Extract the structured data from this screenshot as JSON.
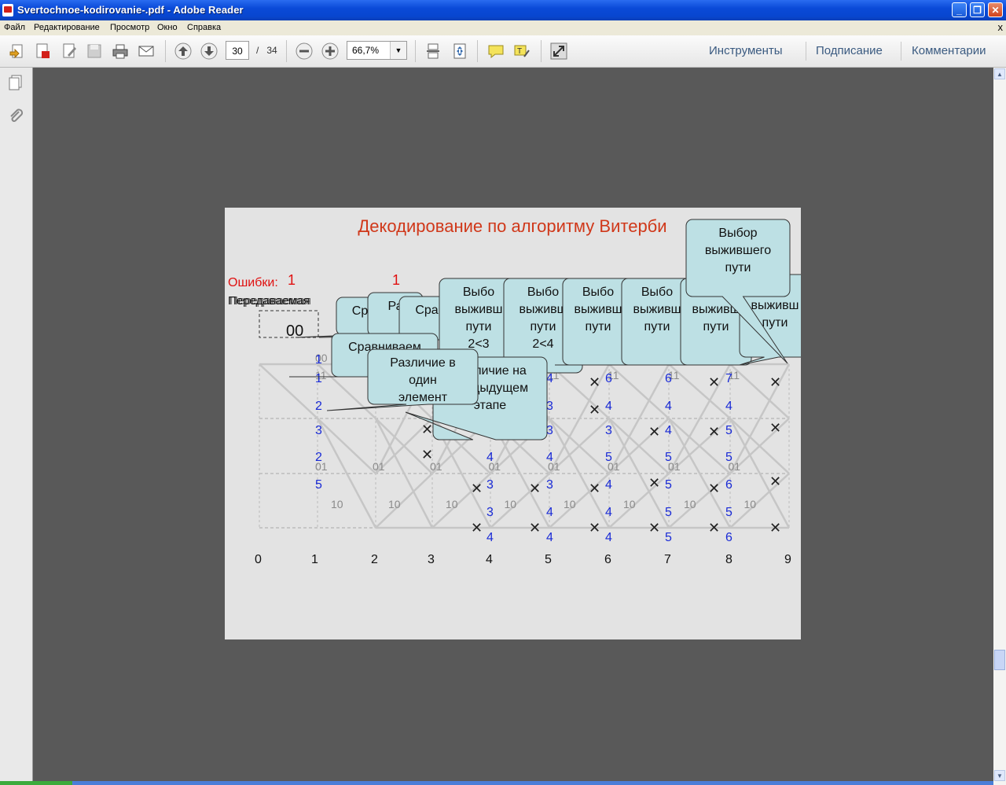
{
  "window": {
    "title": "Svertochnoe-kodirovanie-.pdf - Adobe Reader"
  },
  "menu": [
    "Файл",
    "Редактирование",
    "Просмотр",
    "Окно",
    "Справка"
  ],
  "menu_close": "x",
  "toolbar": {
    "page_current": "30",
    "page_sep": "/",
    "page_total": "34",
    "zoom": "66,7%",
    "right_links": [
      "Инструменты",
      "Подписание",
      "Комментарии"
    ]
  },
  "slide": {
    "title": "Декодирование по алгоритму Витерби",
    "errors_label": "Ошибки:",
    "errors_vals": [
      "1",
      "1"
    ],
    "seq_label": "Передаваемая",
    "seq_value": "00",
    "stage_labels": [
      "0",
      "1",
      "2",
      "3",
      "4",
      "5",
      "6",
      "7",
      "8",
      "9"
    ],
    "metric_values": [
      [
        "1",
        "1",
        "2",
        "3",
        "2",
        "5",
        "4",
        "3"
      ],
      [
        "2",
        "2",
        "3",
        "5",
        "4",
        "3",
        "3",
        "4"
      ],
      [
        "5",
        "4",
        "3",
        "3",
        "4",
        "3",
        "4",
        "4"
      ],
      [
        "2",
        "6",
        "4",
        "3",
        "5",
        "4",
        "4",
        "4"
      ],
      [
        "2",
        "6",
        "4",
        "4",
        "5",
        "5",
        "5",
        "5"
      ],
      [
        "2",
        "7",
        "4",
        "5",
        "5",
        "6",
        "5",
        "6"
      ]
    ],
    "edge_labels": [
      "00",
      "11",
      "01",
      "10"
    ],
    "callouts": {
      "main": [
        "Выбор",
        "выжившего",
        "пути"
      ],
      "diff_one": [
        "Различие в",
        "один",
        "элемент"
      ],
      "compare": "Сравниваем",
      "diff_prev": [
        "Различие на",
        "предыдущем",
        "этапе"
      ],
      "back_fragments": [
        "Выбо",
        "выживш",
        "пути",
        "2<3",
        "2<4",
        "этапе",
        "Ра",
        "Ср",
        "Сра",
        "00",
        "1"
      ]
    }
  }
}
